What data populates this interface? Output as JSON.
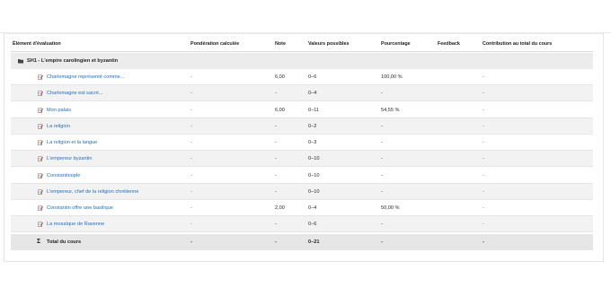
{
  "columns": [
    "Élément d'évaluation",
    "Pondération calculée",
    "Note",
    "Valeurs possibles",
    "Pourcentage",
    "Feedback",
    "Contribution au total du cours"
  ],
  "category": {
    "name": "SH1 - L'empire carolingien et byzantin"
  },
  "items": [
    {
      "name": "Charlemagne représenté comme...",
      "weight": "-",
      "grade": "6,00",
      "range": "0–6",
      "percent": "100,00 %",
      "feedback": "",
      "contribution": "-"
    },
    {
      "name": "Charlemagne est sacré...",
      "weight": "-",
      "grade": "-",
      "range": "0–4",
      "percent": "-",
      "feedback": "",
      "contribution": "-"
    },
    {
      "name": "Mon palais",
      "weight": "-",
      "grade": "6,00",
      "range": "0–11",
      "percent": "54,55 %",
      "feedback": "",
      "contribution": "-"
    },
    {
      "name": "La religion",
      "weight": "-",
      "grade": "-",
      "range": "0–2",
      "percent": "-",
      "feedback": "",
      "contribution": "-"
    },
    {
      "name": "La religion et la langue",
      "weight": "-",
      "grade": "-",
      "range": "0–3",
      "percent": "-",
      "feedback": "",
      "contribution": "-"
    },
    {
      "name": "L'empereur byzantin",
      "weight": "-",
      "grade": "-",
      "range": "0–10",
      "percent": "-",
      "feedback": "",
      "contribution": "-"
    },
    {
      "name": "Constantinople",
      "weight": "-",
      "grade": "-",
      "range": "0–10",
      "percent": "-",
      "feedback": "",
      "contribution": "-"
    },
    {
      "name": "L'empereur, chef de la religion chrétienne",
      "weight": "-",
      "grade": "-",
      "range": "0–10",
      "percent": "-",
      "feedback": "",
      "contribution": "-"
    },
    {
      "name": "Constantin offre une basilique",
      "weight": "-",
      "grade": "2,00",
      "range": "0–4",
      "percent": "50,00 %",
      "feedback": "",
      "contribution": "-"
    },
    {
      "name": "La mosaïque de Ravenne",
      "weight": "-",
      "grade": "-",
      "range": "0–6",
      "percent": "-",
      "feedback": "",
      "contribution": "-"
    }
  ],
  "total": {
    "label": "Total du cours",
    "weight": "-",
    "grade": "-",
    "range": "0–21",
    "percent": "-",
    "feedback": "",
    "contribution": "-"
  },
  "icons": {
    "category": "folder-icon",
    "item": "assignment-icon",
    "total": "sigma-icon"
  },
  "colors": {
    "link": "#1f6fbf",
    "row_alt": "#f2f2f2",
    "category_bg": "#ececec",
    "total_bg": "#e6e6e6"
  }
}
